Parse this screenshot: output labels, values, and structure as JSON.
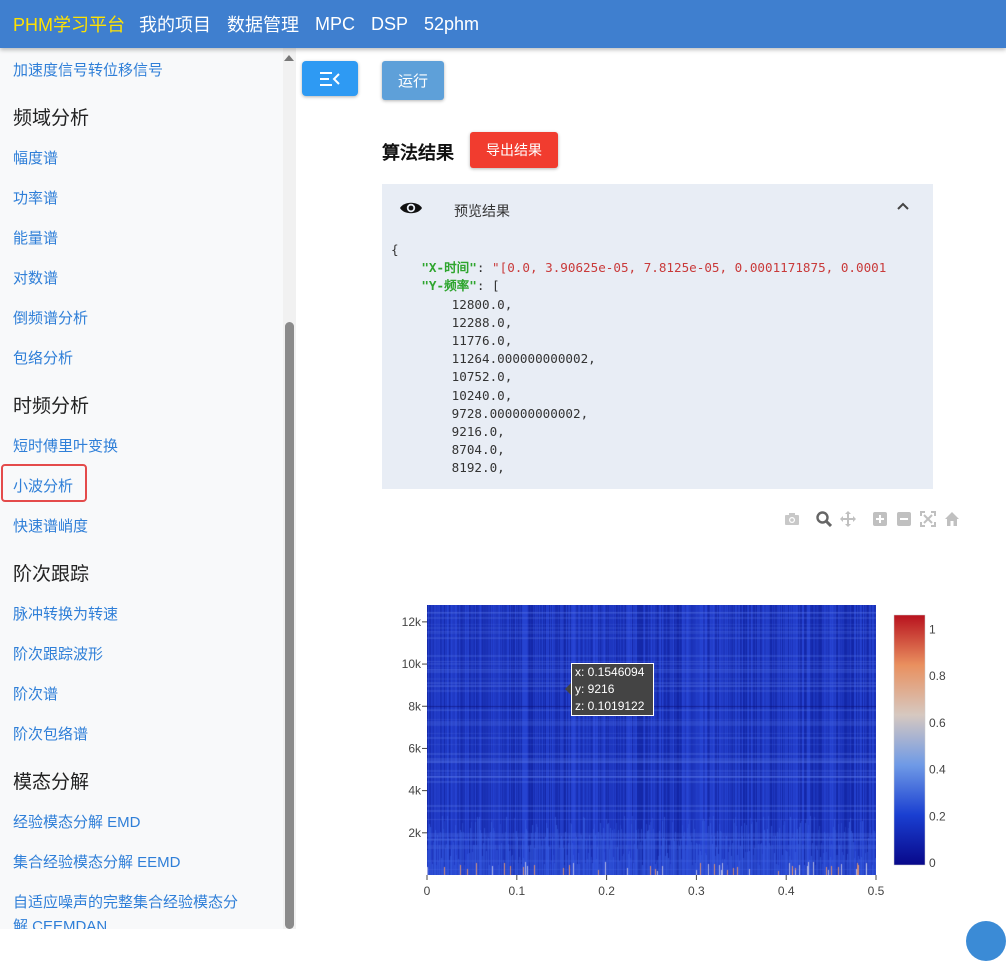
{
  "nav": {
    "brand": "PHM学习平台",
    "links": [
      "我的项目",
      "数据管理",
      "MPC",
      "DSP",
      "52phm"
    ]
  },
  "sidebar": {
    "items": [
      {
        "type": "link",
        "label": "加速度信号转位移信号"
      },
      {
        "type": "heading",
        "label": "频域分析"
      },
      {
        "type": "link",
        "label": "幅度谱"
      },
      {
        "type": "link",
        "label": "功率谱"
      },
      {
        "type": "link",
        "label": "能量谱"
      },
      {
        "type": "link",
        "label": "对数谱"
      },
      {
        "type": "link",
        "label": "倒频谱分析"
      },
      {
        "type": "link",
        "label": "包络分析"
      },
      {
        "type": "heading",
        "label": "时频分析"
      },
      {
        "type": "link",
        "label": "短时傅里叶变换"
      },
      {
        "type": "link",
        "label": "小波分析",
        "active": true
      },
      {
        "type": "link",
        "label": "快速谱峭度"
      },
      {
        "type": "heading",
        "label": "阶次跟踪"
      },
      {
        "type": "link",
        "label": "脉冲转换为转速"
      },
      {
        "type": "link",
        "label": "阶次跟踪波形"
      },
      {
        "type": "link",
        "label": "阶次谱"
      },
      {
        "type": "link",
        "label": "阶次包络谱"
      },
      {
        "type": "heading",
        "label": "模态分解"
      },
      {
        "type": "link",
        "label": "经验模态分解 EMD"
      },
      {
        "type": "link",
        "label": "集合经验模态分解 EEMD"
      },
      {
        "type": "link",
        "label": "自适应噪声的完整集合经验模态分"
      },
      {
        "type": "link",
        "label": "解 CEEMDAN"
      }
    ]
  },
  "main": {
    "run_label": "运行",
    "result_title": "算法结果",
    "export_label": "导出结果",
    "preview_label": "预览结果",
    "code": {
      "open": "{",
      "key_x": "\"X-时间\"",
      "val_x": "\"[0.0, 3.90625e-05, 7.8125e-05, 0.0001171875, 0.0001",
      "key_y": "\"Y-频率\"",
      "y_open": "[",
      "y_values": [
        "12800.0,",
        "12288.0,",
        "11776.0,",
        "11264.000000000002,",
        "10752.0,",
        "10240.0,",
        "9728.000000000002,",
        "9216.0,",
        "8704.0,",
        "8192.0,"
      ]
    }
  },
  "colors": {
    "nav_bg": "#3f7fcf",
    "brand": "#ffe100",
    "link": "#2f7fd8",
    "active_border": "#e44b4b",
    "export": "#f13c2f",
    "run": "#5ea0d9"
  },
  "chart_data": {
    "type": "heatmap",
    "x_ticks": [
      "0",
      "0.1",
      "0.2",
      "0.3",
      "0.4",
      "0.5"
    ],
    "y_ticks": [
      "2k",
      "4k",
      "6k",
      "8k",
      "10k",
      "12k"
    ],
    "xlim": [
      0,
      0.5
    ],
    "ylim": [
      0,
      12800
    ],
    "colorbar_ticks": [
      "0",
      "0.2",
      "0.4",
      "0.6",
      "0.8",
      "1"
    ],
    "colorscale": [
      "#08088a",
      "#1a3fd1",
      "#6f9ae6",
      "#d6c8c0",
      "#e9905f",
      "#b8121e"
    ],
    "zlim": [
      0,
      1
    ],
    "tooltip": {
      "x": "x: 0.1546094",
      "y": "y: 9216",
      "z": "z: 0.1019122"
    }
  }
}
